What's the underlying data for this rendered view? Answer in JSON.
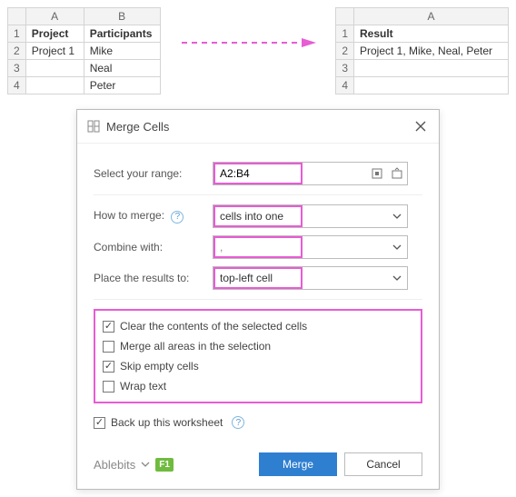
{
  "source_sheet": {
    "col_headers": [
      "A",
      "B"
    ],
    "row_headers": [
      "1",
      "2",
      "3",
      "4"
    ],
    "rows": [
      {
        "a": "Project",
        "b": "Participants"
      },
      {
        "a": "Project 1",
        "b": "Mike"
      },
      {
        "a": "",
        "b": "Neal"
      },
      {
        "a": "",
        "b": "Peter"
      }
    ]
  },
  "result_sheet": {
    "col_headers": [
      "A"
    ],
    "row_headers": [
      "1",
      "2",
      "3",
      "4"
    ],
    "rows": [
      {
        "a": "Result"
      },
      {
        "a": "Project 1, Mike, Neal, Peter"
      },
      {
        "a": ""
      },
      {
        "a": ""
      }
    ]
  },
  "dialog": {
    "title": "Merge Cells",
    "range_label": "Select your range:",
    "range_value": "A2:B4",
    "how_label": "How to merge:",
    "how_value": "cells into one",
    "combine_label": "Combine with:",
    "combine_value": ", ",
    "place_label": "Place the results to:",
    "place_value": "top-left cell",
    "checks": {
      "clear_contents": {
        "label": "Clear the contents of the selected cells",
        "checked": true
      },
      "merge_all_areas": {
        "label": "Merge all areas in the selection",
        "checked": false
      },
      "skip_empty": {
        "label": "Skip empty cells",
        "checked": true
      },
      "wrap_text": {
        "label": "Wrap text",
        "checked": false
      }
    },
    "backup": {
      "label": "Back up this worksheet",
      "checked": true
    },
    "brand": "Ablebits",
    "f1": "F1",
    "merge_btn": "Merge",
    "cancel_btn": "Cancel",
    "help_glyph": "?"
  }
}
